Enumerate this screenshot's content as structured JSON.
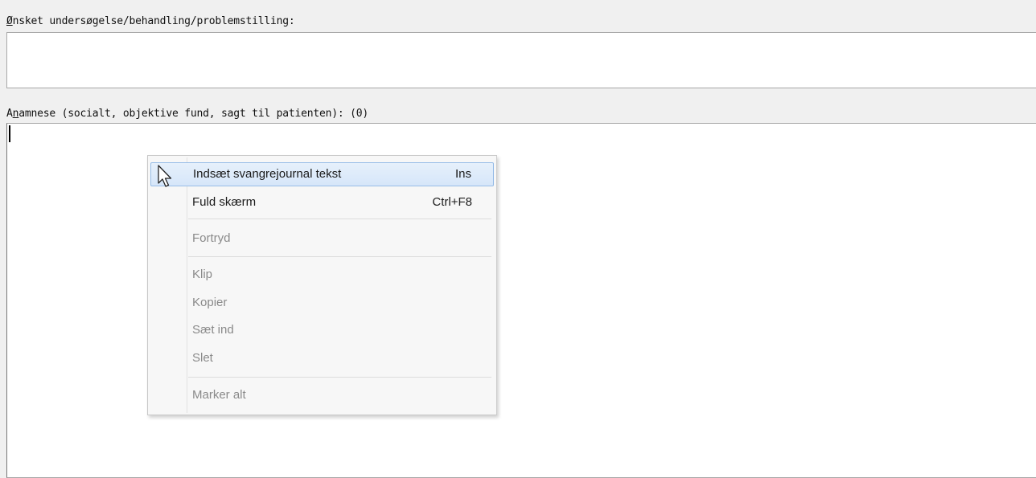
{
  "form": {
    "onsket": {
      "accel": "Ø",
      "label_rest": "nsket undersøgelse/behandling/problemstilling:",
      "value": ""
    },
    "anamnese": {
      "label_pre": "A",
      "accel": "n",
      "label_rest": "amnese (socialt, objektive fund, sagt til patienten): (0)",
      "value": ""
    }
  },
  "context_menu": {
    "items": [
      {
        "label": "Indsæt svangrejournal tekst",
        "shortcut": "Ins",
        "enabled": true,
        "hovered": true
      },
      {
        "label": "Fuld skærm",
        "shortcut": "Ctrl+F8",
        "enabled": true
      },
      {
        "label": "Fortryd",
        "shortcut": "",
        "enabled": false
      },
      {
        "label": "Klip",
        "shortcut": "",
        "enabled": false
      },
      {
        "label": "Kopier",
        "shortcut": "",
        "enabled": false
      },
      {
        "label": "Sæt ind",
        "shortcut": "",
        "enabled": false
      },
      {
        "label": "Slet",
        "shortcut": "",
        "enabled": false
      },
      {
        "label": "Marker alt",
        "shortcut": "",
        "enabled": false
      }
    ],
    "highlight_color": "#d6e6f9",
    "highlight_border_color": "#98bde7"
  },
  "cursor": {
    "icon": "mouse-pointer-icon"
  }
}
